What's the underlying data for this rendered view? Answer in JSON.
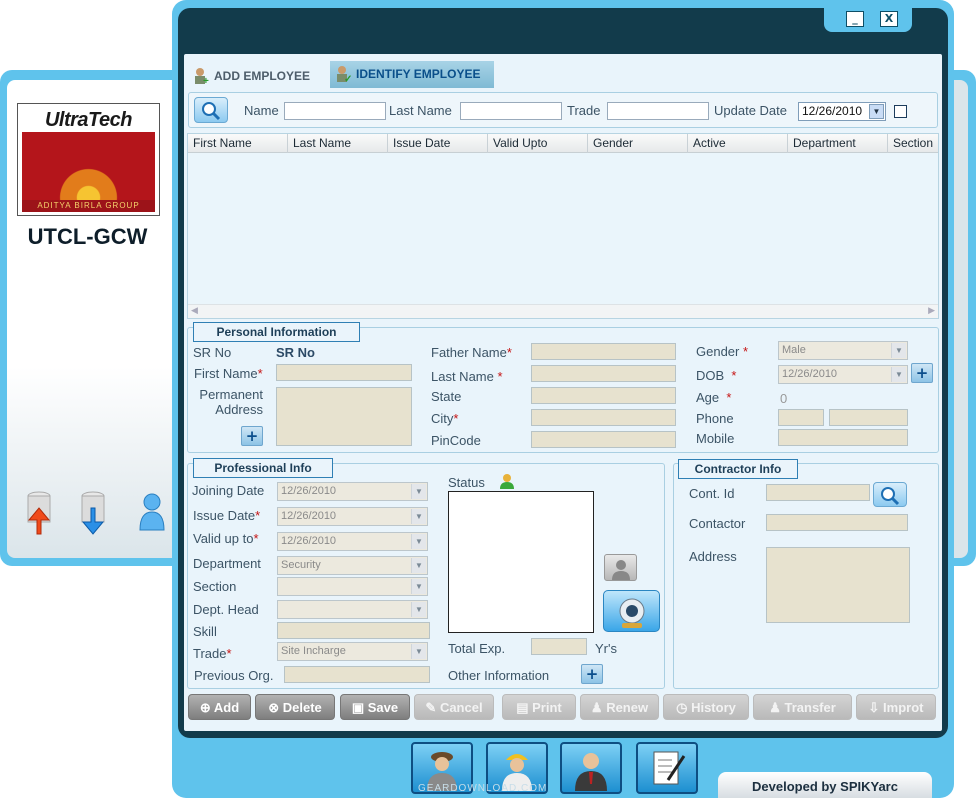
{
  "logo": {
    "name": "UltraTech",
    "group": "ADITYA BIRLA GROUP",
    "site_code": "UTCL-GCW"
  },
  "window": {
    "minimize": "_",
    "close": "X"
  },
  "tabs": [
    {
      "label": "ADD EMPLOYEE"
    },
    {
      "label": "IDENTIFY EMPLOYEE"
    }
  ],
  "search": {
    "name_label": "Name",
    "last_name_label": "Last Name",
    "trade_label": "Trade",
    "update_date_label": "Update Date",
    "update_date_value": "12/26/2010"
  },
  "grid": {
    "columns": [
      "First Name",
      "Last Name",
      "Issue Date",
      "Valid Upto",
      "Gender",
      "Active",
      "Department",
      "Section"
    ]
  },
  "personal": {
    "title": "Personal Information",
    "sr_no_label": "SR No",
    "sr_no_value": "SR No",
    "first_name_label": "First Name",
    "permanent_address_label": "Permanent Address",
    "father_name_label": "Father Name",
    "last_name_label": "Last Name",
    "state_label": "State",
    "city_label": "City",
    "pincode_label": "PinCode",
    "gender_label": "Gender",
    "gender_value": "Male",
    "dob_label": "DOB",
    "dob_value": "12/26/2010",
    "age_label": "Age",
    "age_value": "0",
    "phone_label": "Phone",
    "mobile_label": "Mobile"
  },
  "professional": {
    "title": "Professional Info",
    "joining_date_label": "Joining Date",
    "joining_date_value": "12/26/2010",
    "issue_date_label": "Issue Date",
    "issue_date_value": "12/26/2010",
    "valid_up_to_label": "Valid up to",
    "valid_up_to_value": "12/26/2010",
    "department_label": "Department",
    "department_value": "Security",
    "section_label": "Section",
    "dept_head_label": "Dept. Head",
    "skill_label": "Skill",
    "trade_label": "Trade",
    "trade_value": "Site Incharge",
    "previous_org_label": "Previous Org.",
    "status_label": "Status",
    "total_exp_label": "Total Exp.",
    "total_exp_unit": "Yr's",
    "other_info_label": "Other Information"
  },
  "contractor": {
    "title": "Contractor Info",
    "cont_id_label": "Cont. Id",
    "contactor_label": "Contactor",
    "address_label": "Address"
  },
  "buttons": {
    "add": "Add",
    "delete": "Delete",
    "save": "Save",
    "cancel": "Cancel",
    "print": "Print",
    "renew": "Renew",
    "history": "History",
    "transfer": "Transfer",
    "import": "Improt"
  },
  "footer": {
    "developed_by": "Developed by SPIKYarc",
    "watermark": "GEARDOWNLOAD.COM"
  },
  "colors": {
    "frame": "#5fc3ec",
    "dark_frame": "#123b4b",
    "field_bg": "#e7e2cf",
    "required": "#c51313"
  }
}
